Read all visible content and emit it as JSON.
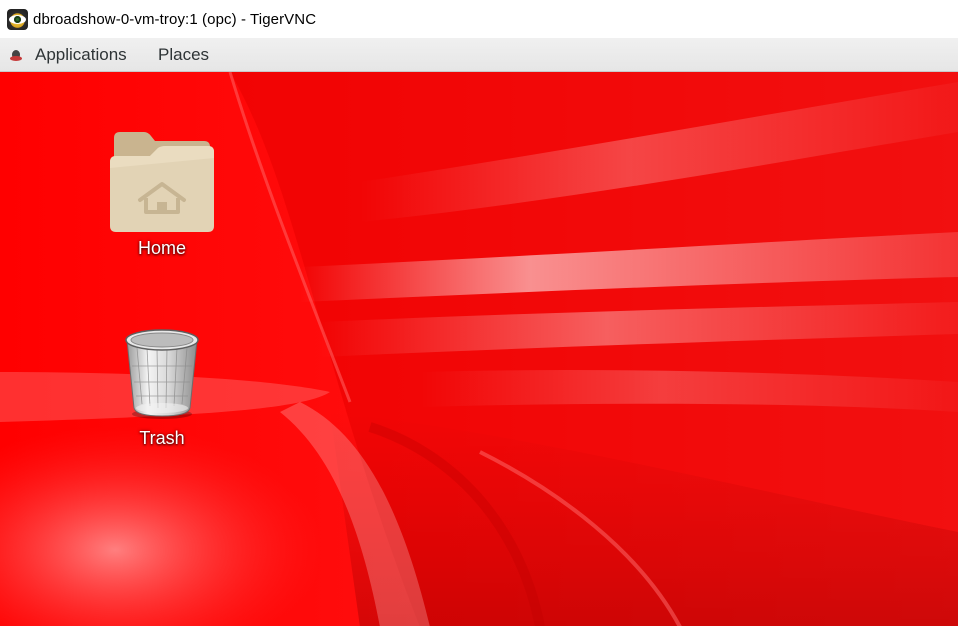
{
  "window": {
    "title": "dbroadshow-0-vm-troy:1 (opc) - TigerVNC",
    "icon": "tigervnc-icon"
  },
  "panel": {
    "applications_label": "Applications",
    "applications_icon": "gnome-foot-icon",
    "places_label": "Places"
  },
  "desktop": {
    "wallpaper_color": "#ff0a0a",
    "icons": [
      {
        "label": "Home",
        "icon": "home-folder-icon"
      },
      {
        "label": "Trash",
        "icon": "trash-icon"
      }
    ]
  }
}
